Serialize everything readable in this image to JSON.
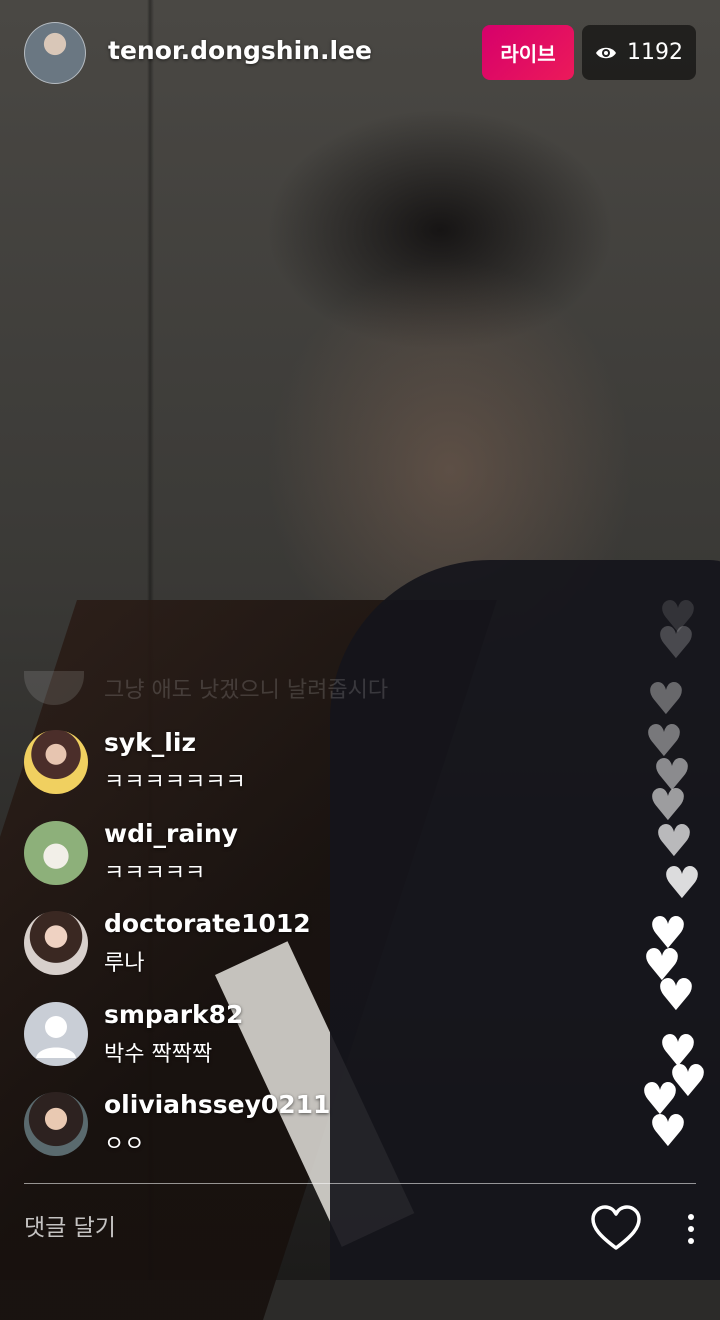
{
  "header": {
    "username": "tenor.dongshin.lee",
    "live_label": "라이브",
    "viewer_count": "1192",
    "accent_color": "#e0005f"
  },
  "ghost_comment": {
    "text": "그냥 애도 낫겠으니 날려줍시다"
  },
  "comments": [
    {
      "username": "syk_liz",
      "text": "ㅋㅋㅋㅋㅋㅋㅋ"
    },
    {
      "username": "wdi_rainy",
      "text": "ㅋㅋㅋㅋㅋ"
    },
    {
      "username": "doctorate1012",
      "text": "루나"
    },
    {
      "username": "smpark82",
      "text": "박수 짝짝짝"
    },
    {
      "username": "oliviahssey0211",
      "text": "ㅇㅇ"
    }
  ],
  "footer": {
    "comment_placeholder": "댓글 달기",
    "like_icon": "heart-outline-icon",
    "more_icon": "more-vertical-icon"
  }
}
